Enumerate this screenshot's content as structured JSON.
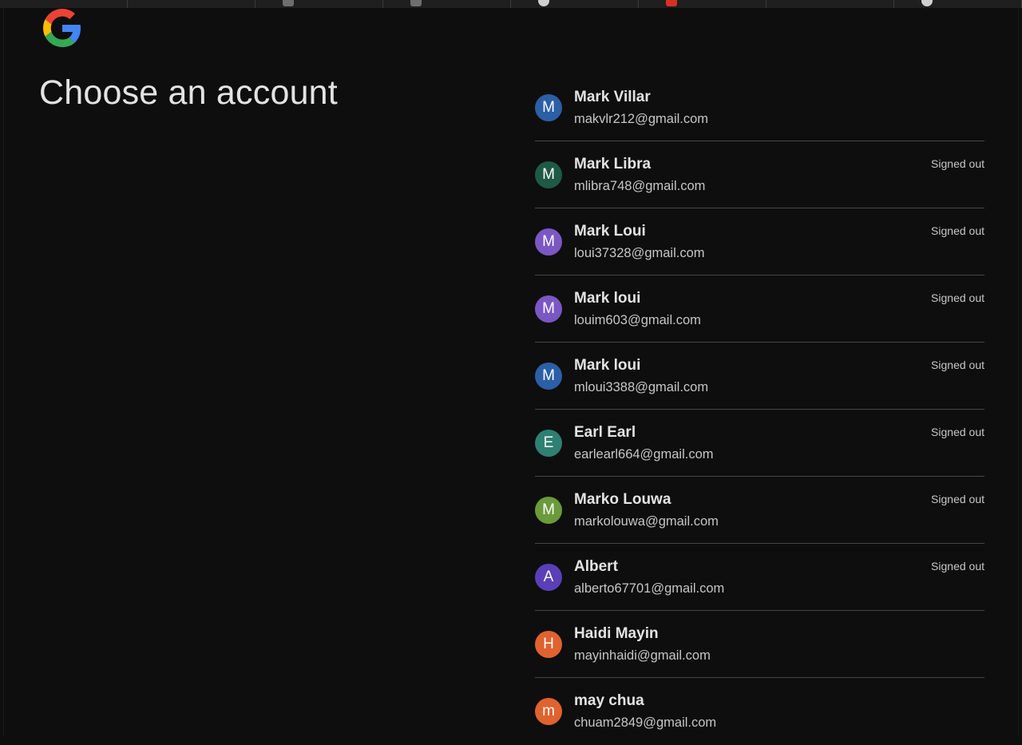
{
  "page": {
    "title": "Choose an account"
  },
  "colors": {
    "background": "#0e0e0e",
    "divider": "#444746",
    "text_primary": "#e3e3e3",
    "text_secondary": "#c4c7c5"
  },
  "browser_tabs": [
    {
      "icon": "tab-icon",
      "icon_color": ""
    },
    {
      "icon": "tab-icon",
      "icon_color": ""
    },
    {
      "icon": "tab-icon",
      "icon_color": "#6e6e6e"
    },
    {
      "icon": "tab-icon",
      "icon_color": "#6e6e6e"
    },
    {
      "icon": "tab-icon",
      "icon_color": "#d0d0d0"
    },
    {
      "icon": "tab-icon",
      "icon_color": "#d93025"
    },
    {
      "icon": "tab-icon",
      "icon_color": ""
    },
    {
      "icon": "tab-icon",
      "icon_color": "#d0d0d0"
    }
  ],
  "accounts": [
    {
      "initial": "M",
      "name": "Mark Villar",
      "email": "makvlr212@gmail.com",
      "status": "",
      "avatar_color": "#2b5fa6"
    },
    {
      "initial": "M",
      "name": "Mark Libra",
      "email": "mlibra748@gmail.com",
      "status": "Signed out",
      "avatar_color": "#1e5a45"
    },
    {
      "initial": "M",
      "name": "Mark Loui",
      "email": "loui37328@gmail.com",
      "status": "Signed out",
      "avatar_color": "#7b57c4"
    },
    {
      "initial": "M",
      "name": "Mark loui",
      "email": "louim603@gmail.com",
      "status": "Signed out",
      "avatar_color": "#7b57c4"
    },
    {
      "initial": "M",
      "name": "Mark loui",
      "email": "mloui3388@gmail.com",
      "status": "Signed out",
      "avatar_color": "#2b5fa6"
    },
    {
      "initial": "E",
      "name": "Earl Earl",
      "email": "earlearl664@gmail.com",
      "status": "Signed out",
      "avatar_color": "#2e8073"
    },
    {
      "initial": "M",
      "name": "Marko Louwa",
      "email": "markolouwa@gmail.com",
      "status": "Signed out",
      "avatar_color": "#6a9a3a"
    },
    {
      "initial": "A",
      "name": "Albert",
      "email": "alberto67701@gmail.com",
      "status": "Signed out",
      "avatar_color": "#5a3fb8"
    },
    {
      "initial": "H",
      "name": "Haidi Mayin",
      "email": "mayinhaidi@gmail.com",
      "status": "",
      "avatar_color": "#e0622e"
    },
    {
      "initial": "m",
      "name": "may chua",
      "email": "chuam2849@gmail.com",
      "status": "",
      "avatar_color": "#e0622e"
    }
  ]
}
